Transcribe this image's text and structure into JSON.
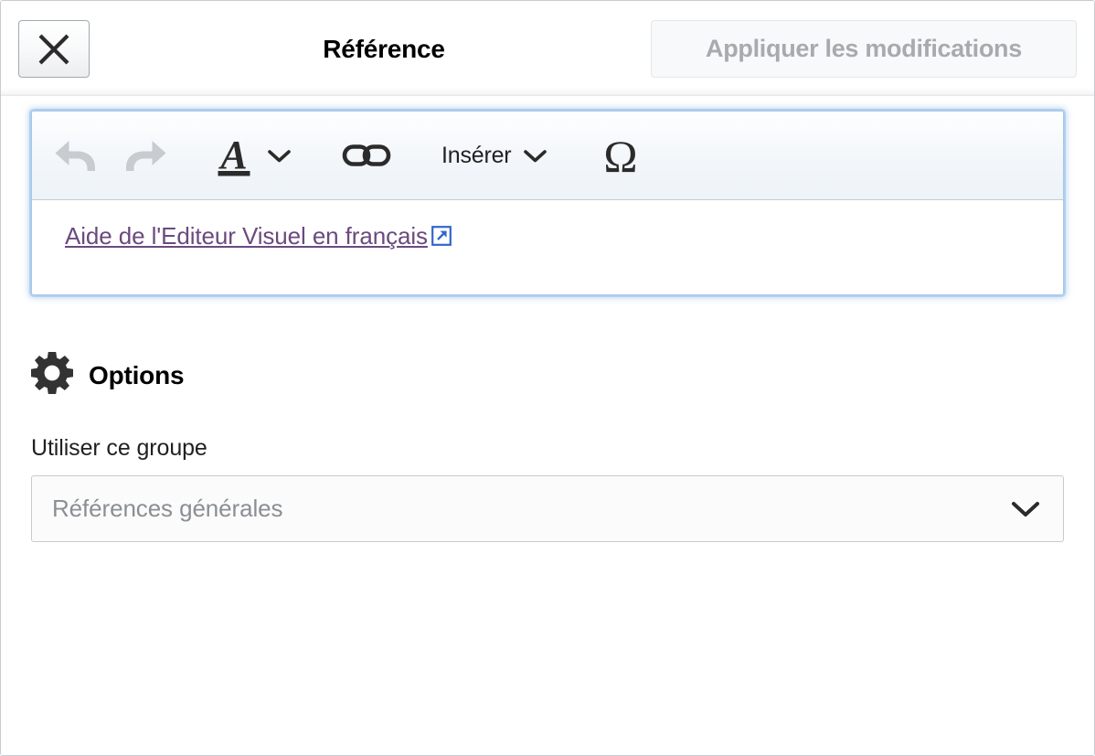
{
  "header": {
    "title": "Référence",
    "close_label": "Fermer",
    "apply_label": "Appliquer les modifications",
    "apply_disabled": true
  },
  "editor": {
    "toolbar": [
      {
        "name": "undo",
        "label": "Annuler",
        "icon": "undo-icon",
        "disabled": true
      },
      {
        "name": "redo",
        "label": "Refaire",
        "icon": "redo-icon",
        "disabled": true
      },
      {
        "name": "text-style",
        "label": "Style du texte",
        "icon": "text-style-icon",
        "has_caret": true,
        "disabled": false
      },
      {
        "name": "link",
        "label": "Lien",
        "icon": "link-icon",
        "disabled": false
      },
      {
        "name": "insert",
        "label": "Insérer",
        "icon": "",
        "has_caret": true,
        "disabled": false
      },
      {
        "name": "special-character",
        "label": "Caractère spécial",
        "icon": "omega-icon",
        "disabled": false
      }
    ],
    "insert_label": "Insérer",
    "content_link_text": "Aide de l'Editeur Visuel en français",
    "content_link_external_icon": "external-link-icon"
  },
  "options": {
    "icon": "gear-icon",
    "title": "Options",
    "group_field_label": "Utiliser ce groupe",
    "group_select_value": "Références générales",
    "group_select_caret": "chevron-down-icon"
  },
  "colors": {
    "focus_ring": "#8ab8e7",
    "toolbar_bg": "#eef3f8",
    "link_purple": "#6b4a7e",
    "external_icon_blue": "#3366cc",
    "disabled_icon": "#c8ccd1",
    "icon_dark": "#333333",
    "placeholder_grey": "#8b8f94",
    "border_grey": "#c8ccd1"
  }
}
